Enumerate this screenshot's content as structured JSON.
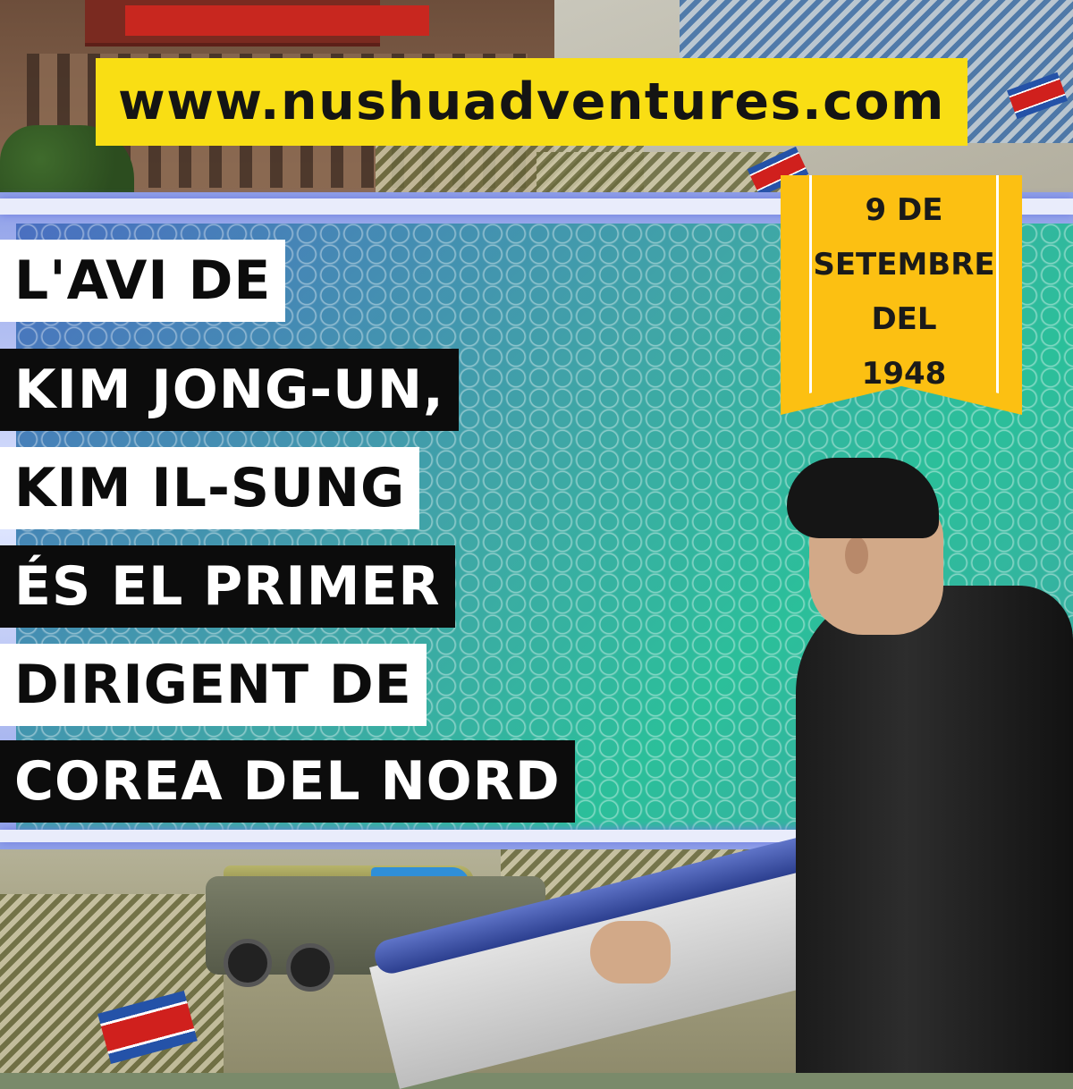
{
  "site": {
    "url": "www.nushuadventures.com"
  },
  "headline": {
    "lines": [
      "L'AVI DE",
      "KIM JONG-UN,",
      "KIM IL-SUNG",
      "ÉS EL PRIMER",
      "DIRIGENT DE",
      "COREA DEL NORD"
    ]
  },
  "date_ribbon": {
    "lines": [
      "9 DE",
      "SETEMBRE",
      "DEL",
      "1948"
    ]
  },
  "colors": {
    "banner": "#f9de14",
    "ribbon": "#fcc012",
    "headline_bg": "#0c0c0c"
  }
}
